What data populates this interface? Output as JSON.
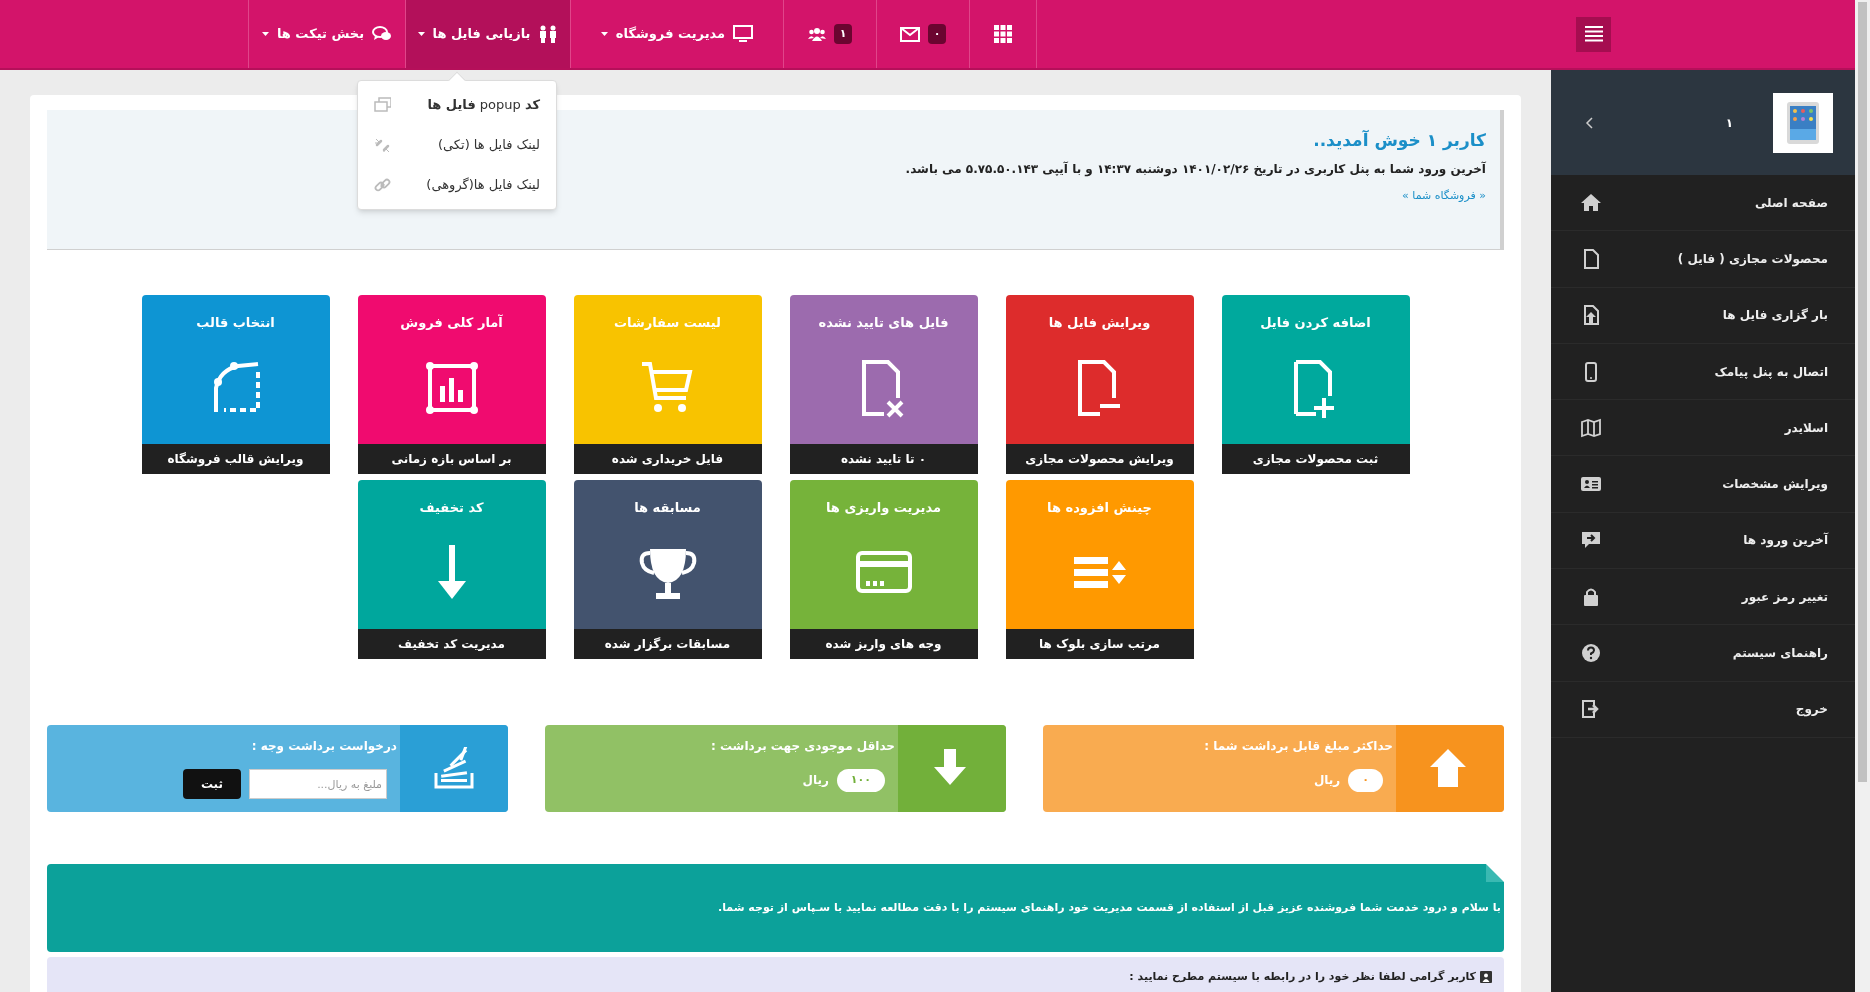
{
  "topbar": {
    "mail_badge": "۰",
    "users_badge": "۱"
  },
  "nav": [
    {
      "label": "مدیریت فروشگاه",
      "kind": "monitor",
      "selected": false
    },
    {
      "label": "بازیابی فایل ها",
      "kind": "users",
      "selected": true
    },
    {
      "label": "بخش تیکت ها",
      "kind": "comments",
      "selected": false
    }
  ],
  "dropdown": [
    {
      "text": "**کد** popup **فایل ها**",
      "kind": "copy"
    },
    {
      "text": "لینک فایل ها (تکی)",
      "kind": "unlink"
    },
    {
      "text": "لینک فایل ها(گروهی)",
      "kind": "link"
    }
  ],
  "welcome": {
    "title": "کاربر ۱ خوش آمدید..",
    "text": "آخرین ورود شما به پنل کاربری در تاریخ ۱۴۰۱/۰۲/۲۶ دوشنبه ۱۴:۳۷ و با آیپی ۵.۷۵.۵۰.۱۴۳ می باشد.",
    "link": "« فروشگاه شما »"
  },
  "tile_rows": [
    [
      {
        "title": "اضافه کردن فایل",
        "label": "ثبت محصولات مجازی",
        "kind": "file-plus",
        "color": "#00a99d"
      },
      {
        "title": "ویرایش فایل ها",
        "label": "ویرایش محصولات مجازی",
        "kind": "file-minus",
        "color": "#dd2c2c"
      },
      {
        "title": "فایل های تایید نشده",
        "label": "۰ تا تایید نشده",
        "kind": "file-x",
        "color": "#9c6bae"
      },
      {
        "title": "لیست سفارشات",
        "label": "فایل خریداری شده",
        "kind": "cart",
        "color": "#f8c300"
      },
      {
        "title": "آمار کلی فروش",
        "label": "بر اساس بازه زمانی",
        "kind": "chart",
        "color": "#f00b6f"
      },
      {
        "title": "انتخاب قالب",
        "label": "ویرایش قالب فروشگاه",
        "kind": "vector",
        "color": "#0e95d3"
      }
    ],
    [
      {
        "title": "چینش افزوده ها",
        "label": "مرتب سازی بلوک ها",
        "kind": "sort",
        "color": "#ff9900"
      },
      {
        "title": "مدیریت واریزی ها",
        "label": "وجه های واریز شده",
        "kind": "card",
        "color": "#76b33a"
      },
      {
        "title": "مسابقه ها",
        "label": "مسابقات برگزار شده",
        "kind": "trophy",
        "color": "#43536e"
      },
      {
        "title": "کد تخفیف",
        "label": "مدیریت کد تخفیف",
        "kind": "arrow-down",
        "color": "#00a79d"
      }
    ]
  ],
  "stats": [
    {
      "kind": "maximum",
      "title": "حداکثر مبلغ قابل برداشت شما :",
      "value": "۰",
      "unit": "ریال",
      "color": "#f7931e"
    },
    {
      "kind": "minimum",
      "title": "حداقل موجودی جهت برداشت :",
      "value": "۱۰۰",
      "unit": "ریال",
      "color": "#72b03a"
    },
    {
      "kind": "request",
      "title": "درخواست برداشت وجه :",
      "placeholder": "ملبغ به ریال...",
      "button": "ثبت",
      "color": "#2a9fd6"
    }
  ],
  "notice": "با سلام و درود خدمت شما فروشنده عزیز  قبل از  استفاده از قسمت مدیریت خود راهنمای سیستم را با دقت مطالعه نمایید   با سـپاس از توجه شما.",
  "feedback": "کاربر گرامی لطفا نظر خود را در رابطه با سیستم مطرح نمایید :",
  "sidebar": {
    "user": "۱",
    "items": [
      {
        "label": "صفحه اصلی",
        "kind": "home"
      },
      {
        "label": "محصولات مجازی ( فایل )",
        "kind": "file"
      },
      {
        "label": "بار گزاری فایل ها",
        "kind": "upload"
      },
      {
        "label": "اتصال به پنل پیامک",
        "kind": "mobile"
      },
      {
        "label": "اسلایدر",
        "kind": "map"
      },
      {
        "label": "ویرایش مشخصات",
        "kind": "idcard"
      },
      {
        "label": "آخرین ورود ها",
        "kind": "chat"
      },
      {
        "label": "تغییر رمز عبور",
        "kind": "lock"
      },
      {
        "label": "راهنمای سیستم",
        "kind": "help"
      },
      {
        "label": "خروج",
        "kind": "exit"
      }
    ]
  }
}
